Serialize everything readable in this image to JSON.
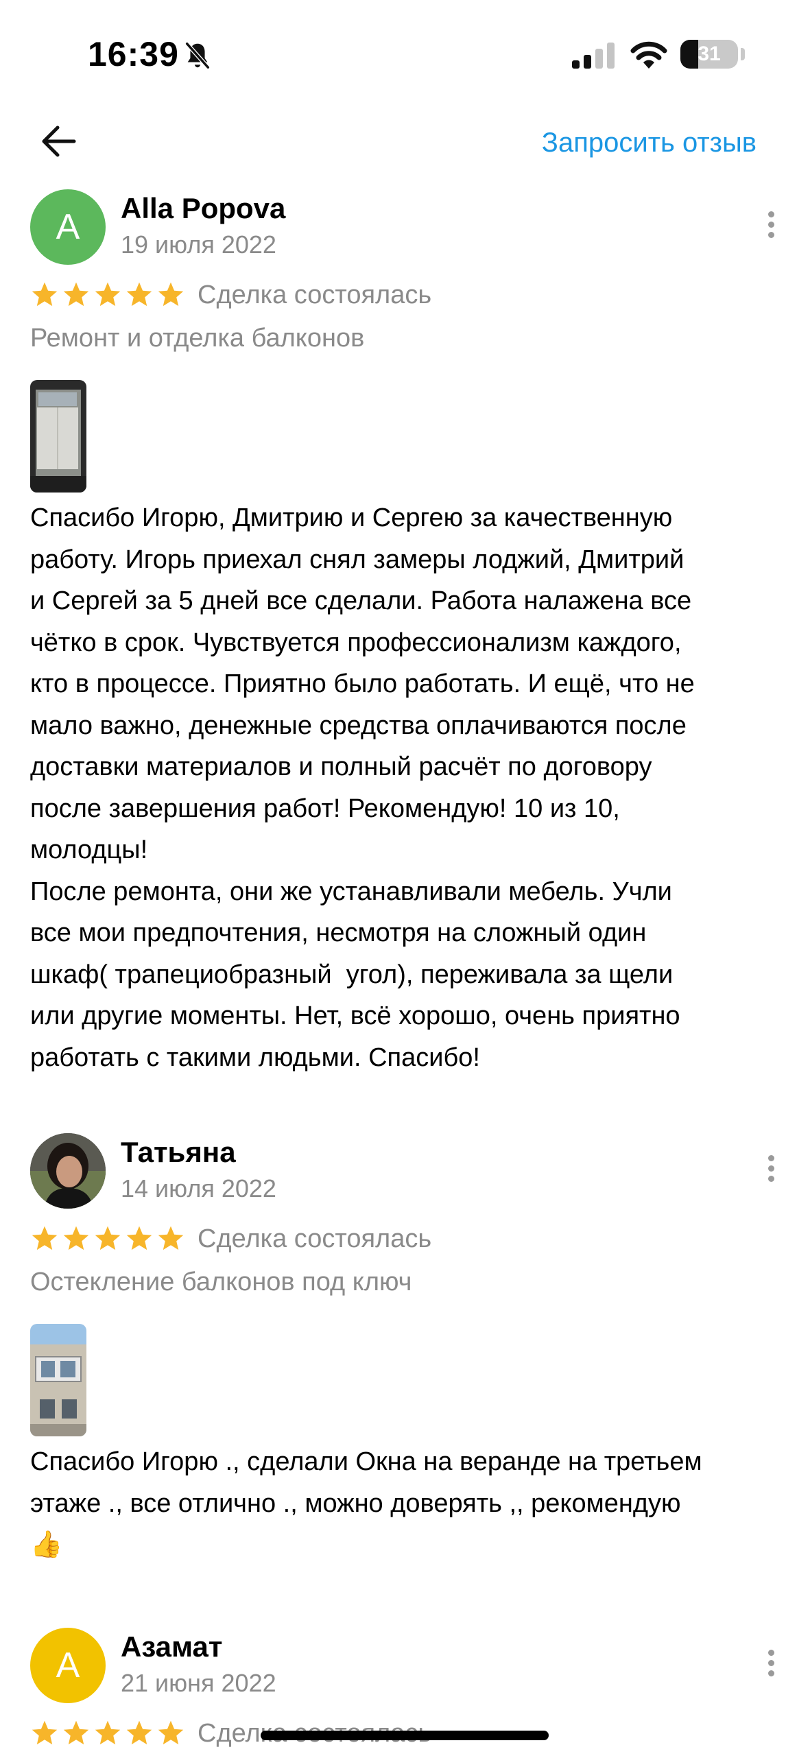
{
  "status_bar": {
    "time": "16:39",
    "battery": "31",
    "battery_level": 0.31,
    "icons": [
      "bell-off-icon",
      "cellular-signal-icon",
      "wifi-icon",
      "battery-icon"
    ]
  },
  "header": {
    "back_icon": "arrow-left-icon",
    "request_review_label": "Запросить отзыв"
  },
  "colors": {
    "link": "#1a96e3",
    "star": "#f7b52a",
    "secondary_text": "#8a8a8a",
    "avatar_green": "#5cb85c",
    "avatar_yellow": "#f2c200"
  },
  "reviews": [
    {
      "author": "Alla Popova",
      "avatar_letter": "A",
      "date": "19 июля 2022",
      "rating": 5,
      "deal_status": "Сделка состоялась",
      "service": "Ремонт и отделка балконов",
      "text": "Спасибо Игорю, Дмитрию и Сергею за качественную\nработу. Игорь приехал снял замеры лоджий, Дмитрий\nи Сергей за 5 дней все сделали. Работа налажена все\nчётко в срок. Чувствуется профессионализм каждого,\nкто в процессе. Приятно было работать. И ещё, что не\nмало важно, денежные средства оплачиваются после\nдоставки материалов и полный расчёт по договору\nпосле завершения работ! Рекомендую! 10 из 10,\nмолодцы!\nПосле ремонта, они же устанавливали мебель. Учли\nвсе мои предпочтения, несмотря на сложный один\nшкаф( трапециобразный  угол), переживала за щели\nили другие моменты. Нет, всё хорошо, очень приятно\nработать с такими людьми. Спасибо!"
    },
    {
      "author": "Татьяна",
      "date": "14 июля 2022",
      "rating": 5,
      "deal_status": "Сделка состоялась",
      "service": "Остекление балконов под ключ",
      "text": "Спасибо Игорю ., сделали Окна на веранде на третьем\nэтаже ., все отлично ., можно доверять ,, рекомендую\n👍"
    },
    {
      "author": "Азамат",
      "avatar_letter": "А",
      "date": "21 июня 2022",
      "rating": 5,
      "deal_status": "Сделка состоялась"
    }
  ]
}
